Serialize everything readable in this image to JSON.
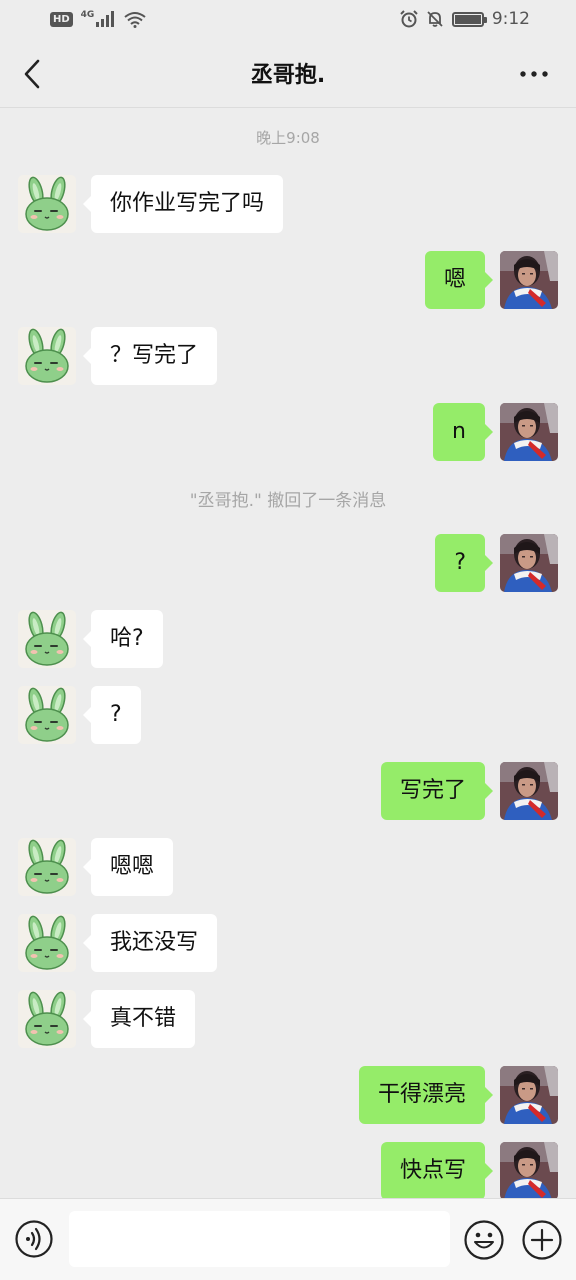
{
  "status_bar": {
    "hd": "HD",
    "network": "4G",
    "time": "9:12",
    "icons": [
      "signal-icon",
      "wifi-icon",
      "alarm-icon",
      "mute-icon",
      "battery-icon"
    ]
  },
  "header": {
    "title": "丞哥抱.",
    "back_icon": "chevron-left-icon",
    "more_icon": "more-dots-icon"
  },
  "chat": {
    "timestamp": "晚上9:08",
    "system_message": "\"丞哥抱.\" 撤回了一条消息",
    "messages": [
      {
        "side": "left",
        "text": "你作业写完了吗"
      },
      {
        "side": "right",
        "text": "嗯"
      },
      {
        "side": "left",
        "text": "？写完了"
      },
      {
        "side": "right",
        "text": "n"
      },
      {
        "side": "right",
        "text": "?"
      },
      {
        "side": "left",
        "text": "哈?"
      },
      {
        "side": "left",
        "text": "?"
      },
      {
        "side": "right",
        "text": "写完了"
      },
      {
        "side": "left",
        "text": "嗯嗯"
      },
      {
        "side": "left",
        "text": "我还没写"
      },
      {
        "side": "left",
        "text": "真不错"
      },
      {
        "side": "right",
        "text": "干得漂亮"
      },
      {
        "side": "right",
        "text": "快点写"
      }
    ]
  },
  "input_bar": {
    "placeholder": "",
    "icons": [
      "voice-icon",
      "emoji-icon",
      "plus-icon"
    ]
  },
  "colors": {
    "background": "#ededed",
    "self_bubble": "#95ec69",
    "other_bubble": "#ffffff",
    "system_text": "#a6a6a6"
  }
}
